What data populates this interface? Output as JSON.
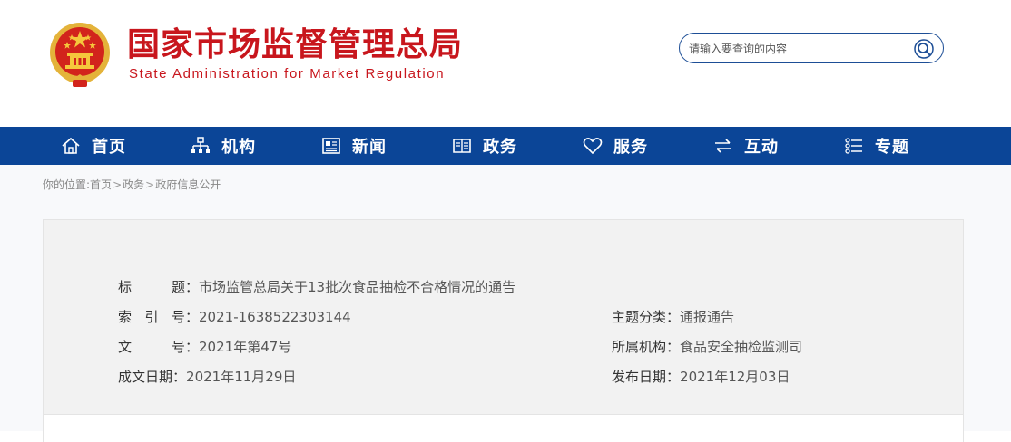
{
  "header": {
    "title_cn": "国家市场监督管理总局",
    "title_en": "State Administration for Market Regulation",
    "brand_color": "#c8161d",
    "emblem_icon": "national-emblem-icon"
  },
  "search": {
    "placeholder": "请输入要查询的内容",
    "icon": "search-icon"
  },
  "nav": {
    "bg_color": "#0b4597",
    "items": [
      {
        "label": "首页",
        "icon": "home-icon"
      },
      {
        "label": "机构",
        "icon": "org-chart-icon"
      },
      {
        "label": "新闻",
        "icon": "newspaper-icon"
      },
      {
        "label": "政务",
        "icon": "government-affairs-icon"
      },
      {
        "label": "服务",
        "icon": "heart-icon"
      },
      {
        "label": "互动",
        "icon": "exchange-arrows-icon"
      },
      {
        "label": "专题",
        "icon": "topic-list-icon"
      }
    ]
  },
  "breadcrumb": {
    "prefix": "你的位置:",
    "items": [
      "首页",
      "政务",
      "政府信息公开"
    ],
    "separator": ">"
  },
  "info": {
    "title_label_a": "标",
    "title_label_b": "题",
    "title_value": "市场监管总局关于13批次食品抽检不合格情况的通告",
    "index_label_a": "索",
    "index_label_b": "引",
    "index_label_c": "号",
    "index_value": "2021-1638522303144",
    "doc_label_a": "文",
    "doc_label_b": "号",
    "doc_value": "2021年第47号",
    "created_label": "成文日期",
    "created_value": "2021年11月29日",
    "topic_label": "主题分类",
    "topic_value": "通报通告",
    "org_label": "所属机构",
    "org_value": "食品安全抽检监测司",
    "published_label": "发布日期",
    "published_value": "2021年12月03日",
    "colon": "："
  }
}
